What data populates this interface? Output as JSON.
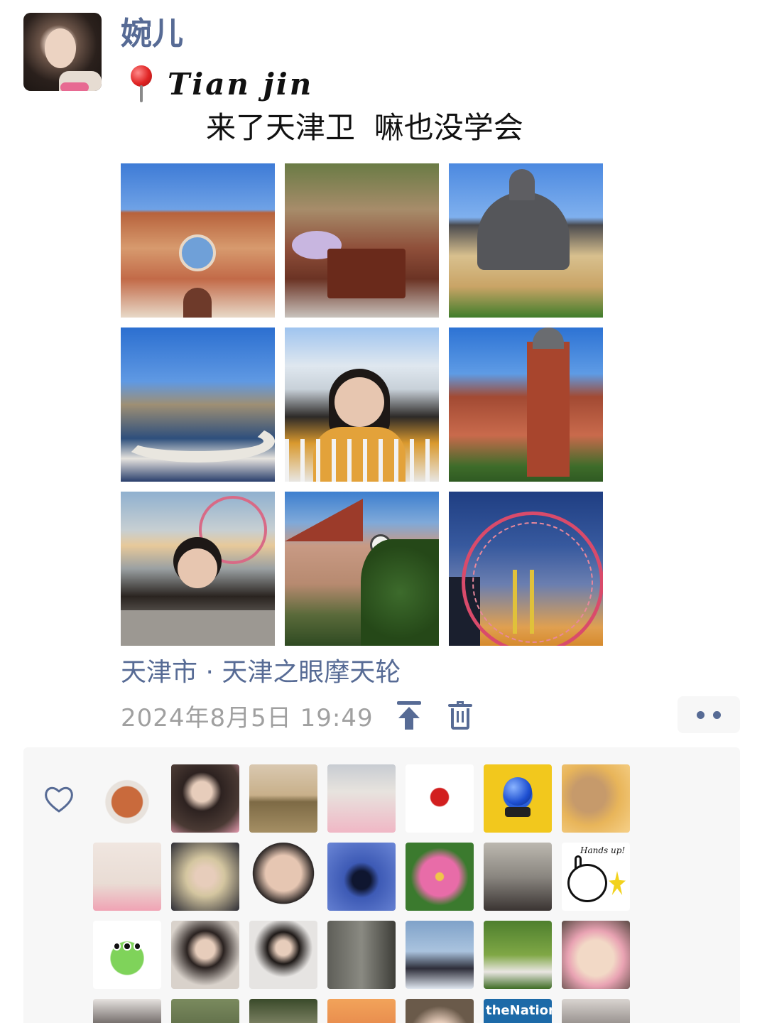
{
  "post": {
    "username": "婉儿",
    "location_line": "Tian jin",
    "caption": "来了天津卫  嘛也没学会",
    "place": "天津市 · 天津之眼摩天轮",
    "timestamp": "2024年8月5日 19:49"
  },
  "photos": [
    {
      "name": "church"
    },
    {
      "name": "piano-garden"
    },
    {
      "name": "dome-building"
    },
    {
      "name": "china-house"
    },
    {
      "name": "river-selfie"
    },
    {
      "name": "red-tower"
    },
    {
      "name": "ferris-wheel-selfie"
    },
    {
      "name": "clock-building"
    },
    {
      "name": "tianjin-eye"
    }
  ],
  "like_avatars": {
    "tiles": [
      {
        "label": ""
      },
      {
        "label": ""
      },
      {
        "label": ""
      },
      {
        "label": ""
      },
      {
        "label": ""
      },
      {
        "label": ""
      },
      {
        "label": ""
      },
      {
        "label": ""
      },
      {
        "label": ""
      },
      {
        "label": ""
      },
      {
        "label": ""
      },
      {
        "label": ""
      },
      {
        "label": ""
      },
      {
        "label": "Hands up!"
      },
      {
        "label": ""
      },
      {
        "label": ""
      },
      {
        "label": ""
      },
      {
        "label": ""
      },
      {
        "label": ""
      },
      {
        "label": ""
      },
      {
        "label": ""
      },
      {
        "label": ""
      },
      {
        "label": ""
      },
      {
        "label": ""
      },
      {
        "label": ""
      },
      {
        "label": ""
      },
      {
        "label": "theNationa"
      },
      {
        "label": ""
      }
    ]
  },
  "colors": {
    "link": "#576b95",
    "timestamp": "#a0a0a0",
    "panel": "#f7f7f7",
    "pin": "#e02424"
  },
  "icons": {
    "pin": "location-pin-icon",
    "pin_top": "pin-to-top-icon",
    "delete": "trash-icon",
    "more": "more-dots-icon",
    "like": "heart-outline-icon"
  }
}
